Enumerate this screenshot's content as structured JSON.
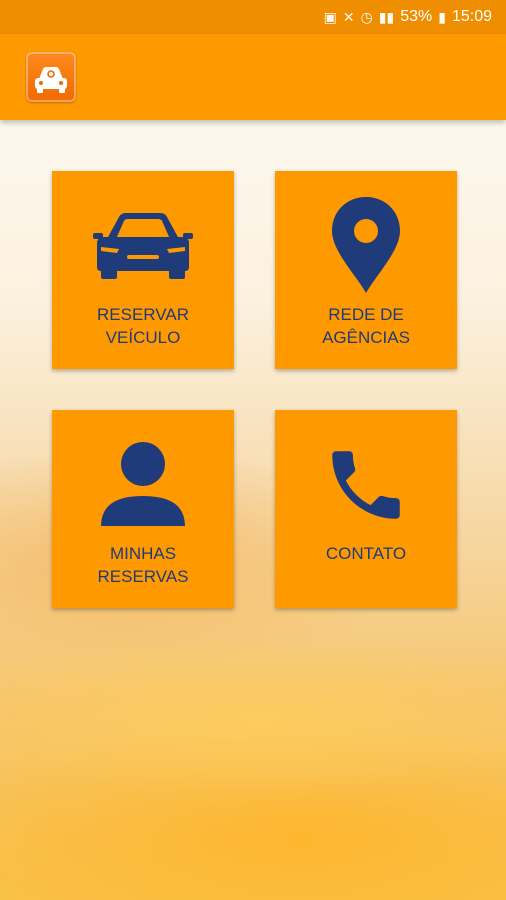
{
  "status_bar": {
    "battery_percent": "53%",
    "time": "15:09"
  },
  "tiles": [
    {
      "label": "RESERVAR\nVEÍCULO",
      "icon": "car-icon"
    },
    {
      "label": "REDE DE\nAGÊNCIAS",
      "icon": "map-pin-icon"
    },
    {
      "label": "MINHAS\nRESERVAS",
      "icon": "person-icon"
    },
    {
      "label": "CONTATO",
      "icon": "phone-icon"
    }
  ],
  "colors": {
    "accent": "#ff9900",
    "status_bar": "#ef8e00",
    "icon_navy": "#1f3b7a"
  }
}
